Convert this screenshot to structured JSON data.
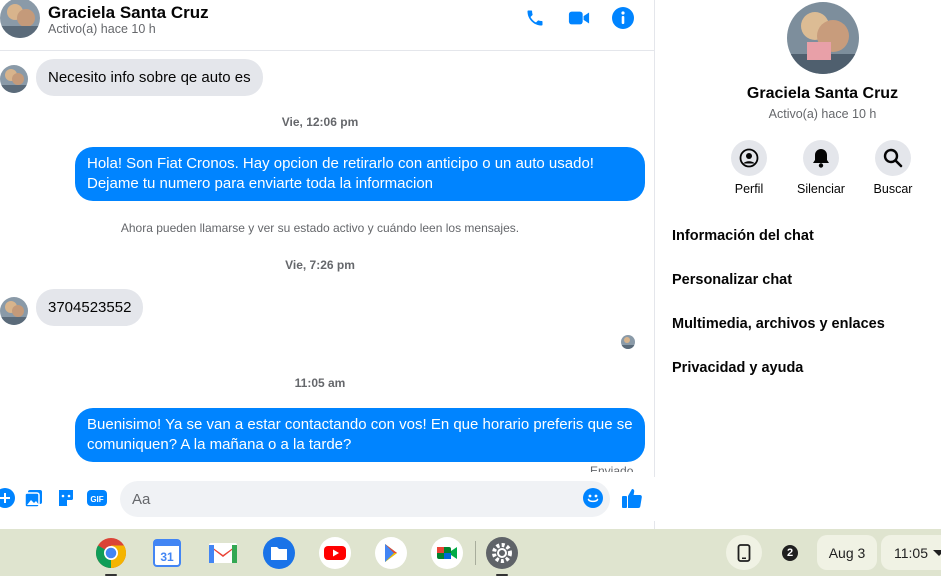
{
  "contact": {
    "name": "Graciela Santa Cruz",
    "status": "Activo(a) hace 10 h"
  },
  "header_icons": [
    "phone-icon",
    "video-camera-icon",
    "info-icon"
  ],
  "colors": {
    "accent": "#0084ff",
    "incoming_bubble": "#e4e6eb",
    "shelf": "#dfe4cf"
  },
  "messages": {
    "m1": "Necesito info sobre qe auto es",
    "ts1": "Vie, 12:06 pm",
    "m2": "Hola! Son Fiat Cronos. Hay opcion de retirarlo con anticipo o un auto usado! Dejame tu numero para enviarte toda la informacion",
    "system_note": "Ahora pueden llamarse y ver su estado activo y cuándo leen los mensajes.",
    "ts2": "Vie, 7:26 pm",
    "m3": "3704523552",
    "ts3": "11:05 am",
    "m4": "Buenisimo! Ya se van a estar contactando con vos! En que horario preferis que se comuniquen? A la mañana o a la tarde?",
    "sent_status": "Enviado"
  },
  "composer": {
    "placeholder": "Aa",
    "icons": [
      "plus-icon",
      "photo-icon",
      "sticker-icon",
      "gif-icon",
      "emoji-icon",
      "like-icon"
    ]
  },
  "info_panel": {
    "actions": [
      {
        "label": "Perfil",
        "icon": "profile-icon"
      },
      {
        "label": "Silenciar",
        "icon": "bell-icon"
      },
      {
        "label": "Buscar",
        "icon": "search-icon"
      }
    ],
    "sections": [
      "Información del chat",
      "Personalizar chat",
      "Multimedia, archivos y enlaces",
      "Privacidad y ayuda"
    ]
  },
  "shelf": {
    "apps": [
      "chrome-icon",
      "calendar-icon",
      "gmail-icon",
      "files-icon",
      "youtube-icon",
      "play-store-icon",
      "meet-icon",
      "settings-icon"
    ],
    "calendar_day": "31",
    "notification_count": "2",
    "date": "Aug 3",
    "time": "11:05"
  }
}
